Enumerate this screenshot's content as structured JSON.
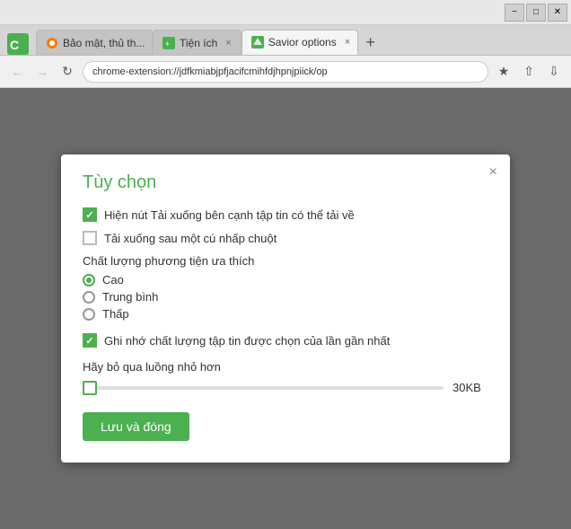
{
  "titlebar": {
    "minimize_label": "−",
    "maximize_label": "□",
    "close_label": "✕"
  },
  "tabs": [
    {
      "id": "tab1",
      "label": "Bảo mật, thủ th...",
      "icon_color": "#f57c00",
      "active": false
    },
    {
      "id": "tab2",
      "label": "Tiện ích",
      "icon_color": "#4caf50",
      "active": false
    },
    {
      "id": "tab3",
      "label": "Savior options",
      "icon_color": "#4caf50",
      "active": true
    }
  ],
  "newtab_label": "+",
  "address": {
    "url": "chrome-extension://jdfkmiabjpfjacifcmihfdjhpnjpiick/op",
    "back_disabled": true,
    "forward_disabled": true
  },
  "modal": {
    "title": "Tùy chọn",
    "close_label": "×",
    "option1_label": "Hiện nút Tải xuống bên cạnh tập tin có thể tải về",
    "option1_checked": true,
    "option2_label": "Tải xuống sau một cú nhấp chuột",
    "option2_checked": false,
    "quality_section_label": "Chất lượng phương tiện ưa thích",
    "quality_options": [
      {
        "label": "Cao",
        "selected": true
      },
      {
        "label": "Trung bình",
        "selected": false
      },
      {
        "label": "Thấp",
        "selected": false
      }
    ],
    "remember_label": "Ghi nhớ chất lượng tập tin được chọn của lần gần nhất",
    "remember_checked": true,
    "slider_section_label": "Hãy bỏ qua luồng nhỏ hơn",
    "slider_value": "30KB",
    "slider_percent": 0,
    "save_btn_label": "Lưu và đóng"
  }
}
